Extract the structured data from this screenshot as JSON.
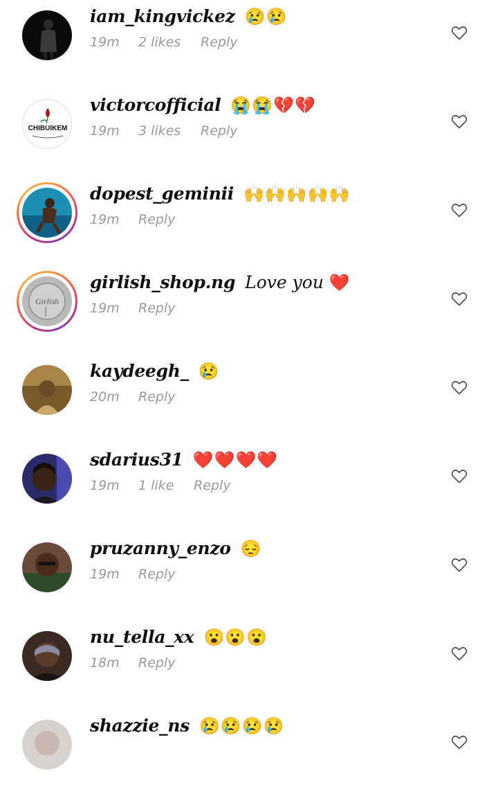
{
  "comments": [
    {
      "username": "iam_kingvickez",
      "text": "",
      "emoji": "😢😢",
      "time": "19m",
      "likes": "2 likes",
      "reply": "Reply",
      "ring": false
    },
    {
      "username": "victorcofficial",
      "text": "",
      "emoji": "😭😭💔💔",
      "time": "19m",
      "likes": "3 likes",
      "reply": "Reply",
      "ring": false,
      "avatar_text": "CHIBUIKEM"
    },
    {
      "username": "dopest_geminii",
      "text": "",
      "emoji": "🙌🙌🙌🙌🙌",
      "time": "19m",
      "likes": "",
      "reply": "Reply",
      "ring": true
    },
    {
      "username": "girlish_shop.ng",
      "text": "Love you",
      "emoji": "❤️",
      "time": "19m",
      "likes": "",
      "reply": "Reply",
      "ring": true,
      "avatar_text": "Girlish"
    },
    {
      "username": "kaydeegh_",
      "text": "",
      "emoji": "😢",
      "time": "20m",
      "likes": "",
      "reply": "Reply",
      "ring": false
    },
    {
      "username": "sdarius31",
      "text": "",
      "emoji": "❤️❤️❤️❤️",
      "time": "19m",
      "likes": "1 like",
      "reply": "Reply",
      "ring": false
    },
    {
      "username": "pruzanny_enzo",
      "text": "",
      "emoji": "😔",
      "time": "19m",
      "likes": "",
      "reply": "Reply",
      "ring": false
    },
    {
      "username": "nu_tella_xx",
      "text": "",
      "emoji": "😮😮😮",
      "time": "18m",
      "likes": "",
      "reply": "Reply",
      "ring": false
    },
    {
      "username": "shazzie_ns",
      "text": "",
      "emoji": "😢😢😢😢",
      "time": "",
      "likes": "",
      "reply": "",
      "ring": false
    }
  ],
  "icons": {
    "like": "heart-outline-icon"
  },
  "colors": {
    "meta_text": "#9a9a9a",
    "heart_stroke": "#555555",
    "story_ring_start": "#f9a03f",
    "story_ring_end": "#c13584"
  }
}
